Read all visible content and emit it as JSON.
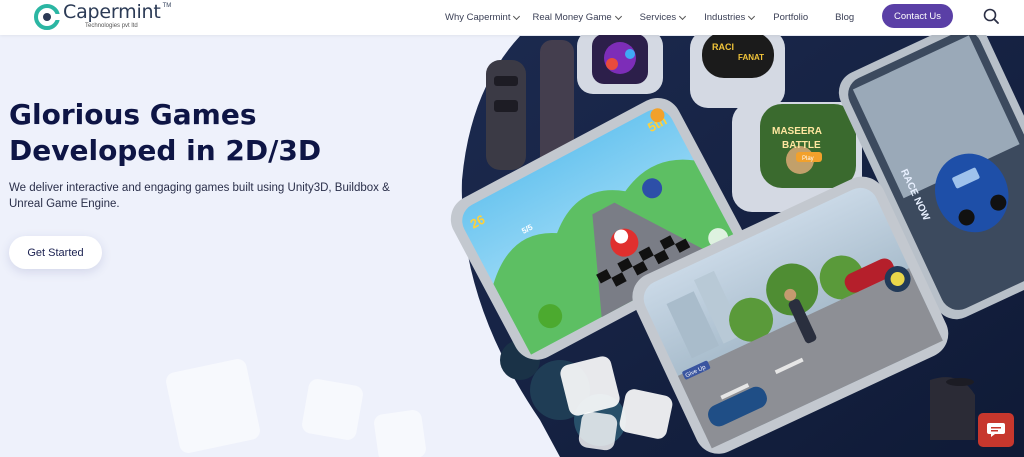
{
  "header": {
    "logo": {
      "name": "Capermint",
      "tm": "TM",
      "subtitle": "Technologies pvt ltd"
    },
    "nav": [
      {
        "label": "Why Capermint",
        "dropdown": true
      },
      {
        "label": "Real Money Game",
        "dropdown": true
      },
      {
        "label": "Services",
        "dropdown": true
      },
      {
        "label": "Industries",
        "dropdown": true
      },
      {
        "label": "Portfolio",
        "dropdown": false
      },
      {
        "label": "Blog",
        "dropdown": false
      }
    ],
    "contact_label": "Contact Us",
    "search_icon": "search-icon"
  },
  "hero": {
    "title_line1": "Glorious Games",
    "title_line2": "Developed in 2D/3D",
    "description": "We deliver interactive and engaging games built using Unity3D, Buildbox & Unreal Game Engine.",
    "cta_label": "Get Started"
  },
  "showcase": {
    "racing_game": {
      "score": "26",
      "position": "5th",
      "laps": "5/5"
    },
    "maseera": {
      "line1": "MASEERA",
      "line2": "BATTLE",
      "play": "Play"
    },
    "race_now": "RACE NOW",
    "shooter": {
      "give_up": "Give Up"
    }
  },
  "colors": {
    "accent": "#5a3fa6",
    "title": "#0e1545",
    "chat": "#c7372d",
    "logo_green": "#2bb6a3"
  },
  "chat_icon": "chat-bubble-icon"
}
